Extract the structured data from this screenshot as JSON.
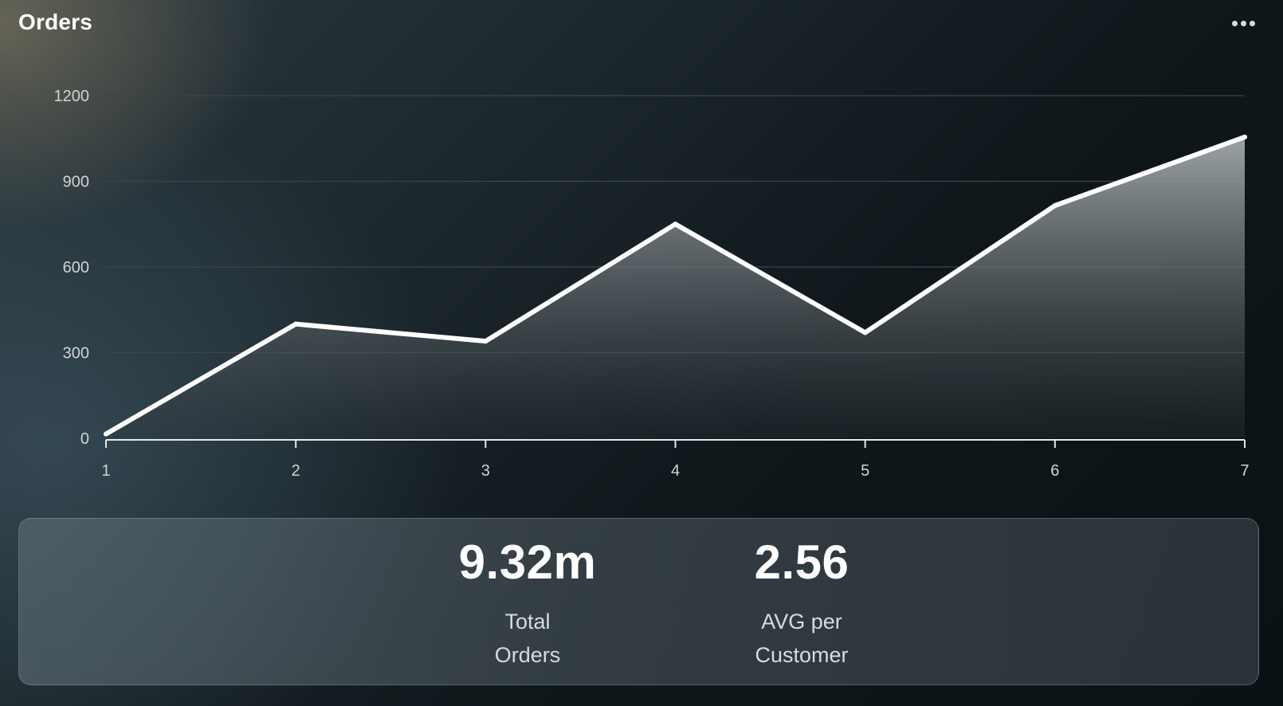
{
  "header": {
    "title": "Orders"
  },
  "chart_data": {
    "type": "area",
    "title": "",
    "xlabel": "",
    "ylabel": "",
    "x": [
      1,
      2,
      3,
      4,
      5,
      6,
      7
    ],
    "values": [
      15,
      400,
      340,
      750,
      370,
      815,
      1055
    ],
    "ylim": [
      0,
      1200
    ],
    "yticks": [
      0,
      300,
      600,
      900,
      1200
    ],
    "xticks": [
      1,
      2,
      3,
      4,
      5,
      6,
      7
    ],
    "grid": true,
    "legend": "none",
    "colors": {
      "line": "#ffffff",
      "fill_top": "#9aa0a3",
      "grid": "#3a464c",
      "axis": "#e6e9ea"
    }
  },
  "stats": [
    {
      "value": "9.32m",
      "label_line1": "Total",
      "label_line2": "Orders"
    },
    {
      "value": "2.56",
      "label_line1": "AVG per",
      "label_line2": "Customer"
    }
  ],
  "icons": {
    "menu": "more-horizontal-icon"
  }
}
